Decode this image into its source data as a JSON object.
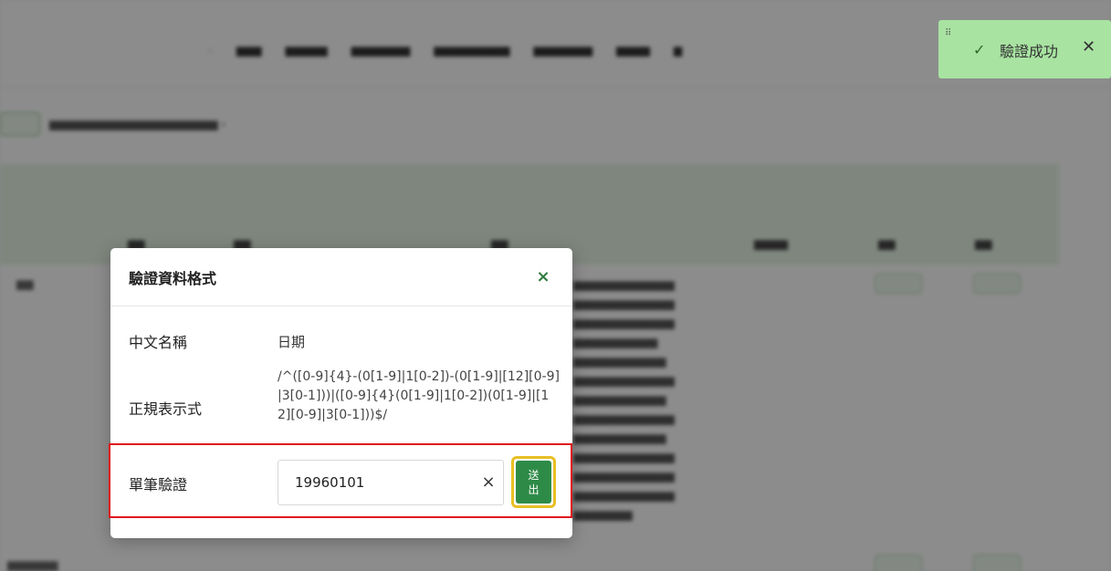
{
  "modal": {
    "title": "驗證資料格式",
    "close_icon": "×",
    "fields": {
      "chinese_name_label": "中文名稱",
      "chinese_name_value": "日期",
      "regex_label": "正規表示式",
      "regex_value": "/^([0-9]{4}-(0[1-9]|1[0-2])-(0[1-9]|[12][0-9]|3[0-1]))|([0-9]{4}(0[1-9]|1[0-2])(0[1-9]|[12][0-9]|3[0-1]))$/",
      "single_verify_label": "單筆驗證"
    },
    "input": {
      "value": "19960101",
      "clear_icon": "×"
    },
    "send_button": "送出"
  },
  "toast": {
    "grip_icon": "⠿",
    "check_icon": "✓",
    "message": "驗證成功",
    "close_icon": "✕",
    "color": "#a8e3a1"
  },
  "colors": {
    "highlight_border": "#e0161c",
    "send_button_bg": "#2e8b47",
    "send_button_focus": "#e9bf25"
  }
}
